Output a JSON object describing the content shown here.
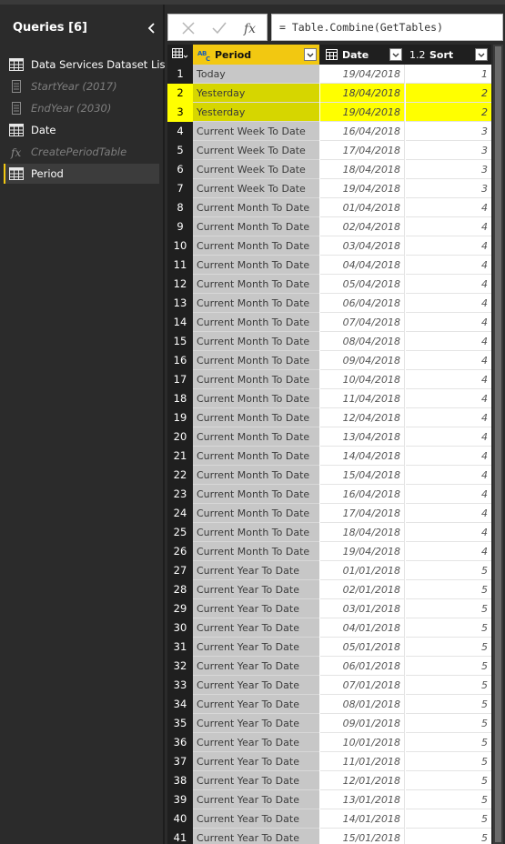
{
  "queries_pane": {
    "title": "Queries [6]",
    "items": [
      {
        "label": "Data Services Dataset List",
        "icon": "table-icon",
        "dim": false,
        "selected": false
      },
      {
        "label": "StartYear (2017)",
        "icon": "parameter-icon",
        "dim": true,
        "selected": false
      },
      {
        "label": "EndYear (2030)",
        "icon": "parameter-icon",
        "dim": true,
        "selected": false
      },
      {
        "label": "Date",
        "icon": "table-icon",
        "dim": false,
        "selected": false
      },
      {
        "label": "CreatePeriodTable",
        "icon": "function-icon",
        "dim": true,
        "selected": false
      },
      {
        "label": "Period",
        "icon": "table-icon",
        "dim": false,
        "selected": true
      }
    ]
  },
  "formula_bar": {
    "formula": "= Table.Combine(GetTables)",
    "cancel_icon": "cancel-icon",
    "commit_icon": "commit-icon",
    "function_icon": "fx-icon"
  },
  "grid": {
    "columns": [
      {
        "name": "Period",
        "type_icon": "text-type-icon",
        "type_text": "ABC"
      },
      {
        "name": "Date",
        "type_icon": "date-type-icon"
      },
      {
        "name": "Sort",
        "type_icon": "decimal-type-icon",
        "type_text": "1.2"
      }
    ],
    "rows": [
      {
        "n": "1",
        "period": "Today",
        "date": "19/04/2018",
        "sort": "1",
        "highlight": false
      },
      {
        "n": "2",
        "period": "Yesterday",
        "date": "18/04/2018",
        "sort": "2",
        "highlight": true
      },
      {
        "n": "3",
        "period": "Yesterday",
        "date": "19/04/2018",
        "sort": "2",
        "highlight": true
      },
      {
        "n": "4",
        "period": "Current Week To Date",
        "date": "16/04/2018",
        "sort": "3",
        "highlight": false
      },
      {
        "n": "5",
        "period": "Current Week To Date",
        "date": "17/04/2018",
        "sort": "3",
        "highlight": false
      },
      {
        "n": "6",
        "period": "Current Week To Date",
        "date": "18/04/2018",
        "sort": "3",
        "highlight": false
      },
      {
        "n": "7",
        "period": "Current Week To Date",
        "date": "19/04/2018",
        "sort": "3",
        "highlight": false
      },
      {
        "n": "8",
        "period": "Current Month To Date",
        "date": "01/04/2018",
        "sort": "4",
        "highlight": false
      },
      {
        "n": "9",
        "period": "Current Month To Date",
        "date": "02/04/2018",
        "sort": "4",
        "highlight": false
      },
      {
        "n": "10",
        "period": "Current Month To Date",
        "date": "03/04/2018",
        "sort": "4",
        "highlight": false
      },
      {
        "n": "11",
        "period": "Current Month To Date",
        "date": "04/04/2018",
        "sort": "4",
        "highlight": false
      },
      {
        "n": "12",
        "period": "Current Month To Date",
        "date": "05/04/2018",
        "sort": "4",
        "highlight": false
      },
      {
        "n": "13",
        "period": "Current Month To Date",
        "date": "06/04/2018",
        "sort": "4",
        "highlight": false
      },
      {
        "n": "14",
        "period": "Current Month To Date",
        "date": "07/04/2018",
        "sort": "4",
        "highlight": false
      },
      {
        "n": "15",
        "period": "Current Month To Date",
        "date": "08/04/2018",
        "sort": "4",
        "highlight": false
      },
      {
        "n": "16",
        "period": "Current Month To Date",
        "date": "09/04/2018",
        "sort": "4",
        "highlight": false
      },
      {
        "n": "17",
        "period": "Current Month To Date",
        "date": "10/04/2018",
        "sort": "4",
        "highlight": false
      },
      {
        "n": "18",
        "period": "Current Month To Date",
        "date": "11/04/2018",
        "sort": "4",
        "highlight": false
      },
      {
        "n": "19",
        "period": "Current Month To Date",
        "date": "12/04/2018",
        "sort": "4",
        "highlight": false
      },
      {
        "n": "20",
        "period": "Current Month To Date",
        "date": "13/04/2018",
        "sort": "4",
        "highlight": false
      },
      {
        "n": "21",
        "period": "Current Month To Date",
        "date": "14/04/2018",
        "sort": "4",
        "highlight": false
      },
      {
        "n": "22",
        "period": "Current Month To Date",
        "date": "15/04/2018",
        "sort": "4",
        "highlight": false
      },
      {
        "n": "23",
        "period": "Current Month To Date",
        "date": "16/04/2018",
        "sort": "4",
        "highlight": false
      },
      {
        "n": "24",
        "period": "Current Month To Date",
        "date": "17/04/2018",
        "sort": "4",
        "highlight": false
      },
      {
        "n": "25",
        "period": "Current Month To Date",
        "date": "18/04/2018",
        "sort": "4",
        "highlight": false
      },
      {
        "n": "26",
        "period": "Current Month To Date",
        "date": "19/04/2018",
        "sort": "4",
        "highlight": false
      },
      {
        "n": "27",
        "period": "Current Year To Date",
        "date": "01/01/2018",
        "sort": "5",
        "highlight": false
      },
      {
        "n": "28",
        "period": "Current Year To Date",
        "date": "02/01/2018",
        "sort": "5",
        "highlight": false
      },
      {
        "n": "29",
        "period": "Current Year To Date",
        "date": "03/01/2018",
        "sort": "5",
        "highlight": false
      },
      {
        "n": "30",
        "period": "Current Year To Date",
        "date": "04/01/2018",
        "sort": "5",
        "highlight": false
      },
      {
        "n": "31",
        "period": "Current Year To Date",
        "date": "05/01/2018",
        "sort": "5",
        "highlight": false
      },
      {
        "n": "32",
        "period": "Current Year To Date",
        "date": "06/01/2018",
        "sort": "5",
        "highlight": false
      },
      {
        "n": "33",
        "period": "Current Year To Date",
        "date": "07/01/2018",
        "sort": "5",
        "highlight": false
      },
      {
        "n": "34",
        "period": "Current Year To Date",
        "date": "08/01/2018",
        "sort": "5",
        "highlight": false
      },
      {
        "n": "35",
        "period": "Current Year To Date",
        "date": "09/01/2018",
        "sort": "5",
        "highlight": false
      },
      {
        "n": "36",
        "period": "Current Year To Date",
        "date": "10/01/2018",
        "sort": "5",
        "highlight": false
      },
      {
        "n": "37",
        "period": "Current Year To Date",
        "date": "11/01/2018",
        "sort": "5",
        "highlight": false
      },
      {
        "n": "38",
        "period": "Current Year To Date",
        "date": "12/01/2018",
        "sort": "5",
        "highlight": false
      },
      {
        "n": "39",
        "period": "Current Year To Date",
        "date": "13/01/2018",
        "sort": "5",
        "highlight": false
      },
      {
        "n": "40",
        "period": "Current Year To Date",
        "date": "14/01/2018",
        "sort": "5",
        "highlight": false
      },
      {
        "n": "41",
        "period": "Current Year To Date",
        "date": "15/01/2018",
        "sort": "5",
        "highlight": false
      }
    ]
  },
  "colors": {
    "selected_column": "#f2c811",
    "row_highlight": "#ffff00",
    "pane_background": "#2b2b2b"
  }
}
